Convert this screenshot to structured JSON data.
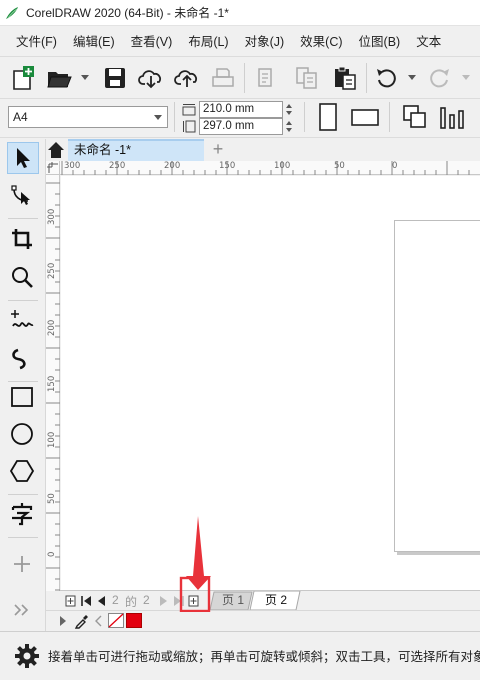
{
  "window": {
    "title": "CorelDRAW 2020 (64-Bit) - 未命名 -1*"
  },
  "menu": [
    {
      "label": "文件(F)"
    },
    {
      "label": "编辑(E)"
    },
    {
      "label": "查看(V)"
    },
    {
      "label": "布局(L)"
    },
    {
      "label": "对象(J)"
    },
    {
      "label": "效果(C)"
    },
    {
      "label": "位图(B)"
    },
    {
      "label": "文本"
    }
  ],
  "property_bar": {
    "page_size": "A4",
    "width": "210.0 mm",
    "height": "297.0 mm"
  },
  "document": {
    "tab_label": "未命名 -1*",
    "add_tab": "+"
  },
  "ruler_h_labels": [
    "300",
    "250",
    "200",
    "150",
    "100",
    "50",
    "0"
  ],
  "ruler_v_labels": [
    "300",
    "250",
    "200",
    "150",
    "100",
    "50",
    "0"
  ],
  "page_navigator": {
    "current": "2",
    "of": "的",
    "total": "2",
    "pages": [
      "页 1",
      "页 2"
    ]
  },
  "status": {
    "hint": "接着单击可进行拖动或缩放；再单击可旋转或倾斜；双击工具，可选择所有对象"
  },
  "colors": {
    "accent": "#1a8a3c",
    "annotation": "#e8323a",
    "fill_swatch": "#e3000f",
    "active_tab": "#cfe5f8"
  },
  "icons": {
    "toolbox": [
      "pick-tool-icon",
      "shape-tool-icon",
      "crop-tool-icon",
      "zoom-tool-icon",
      "freehand-tool-icon",
      "artistic-media-icon",
      "rectangle-tool-icon",
      "ellipse-tool-icon",
      "polygon-tool-icon",
      "text-tool-icon",
      "add-tool-icon",
      "expand-icon"
    ]
  }
}
